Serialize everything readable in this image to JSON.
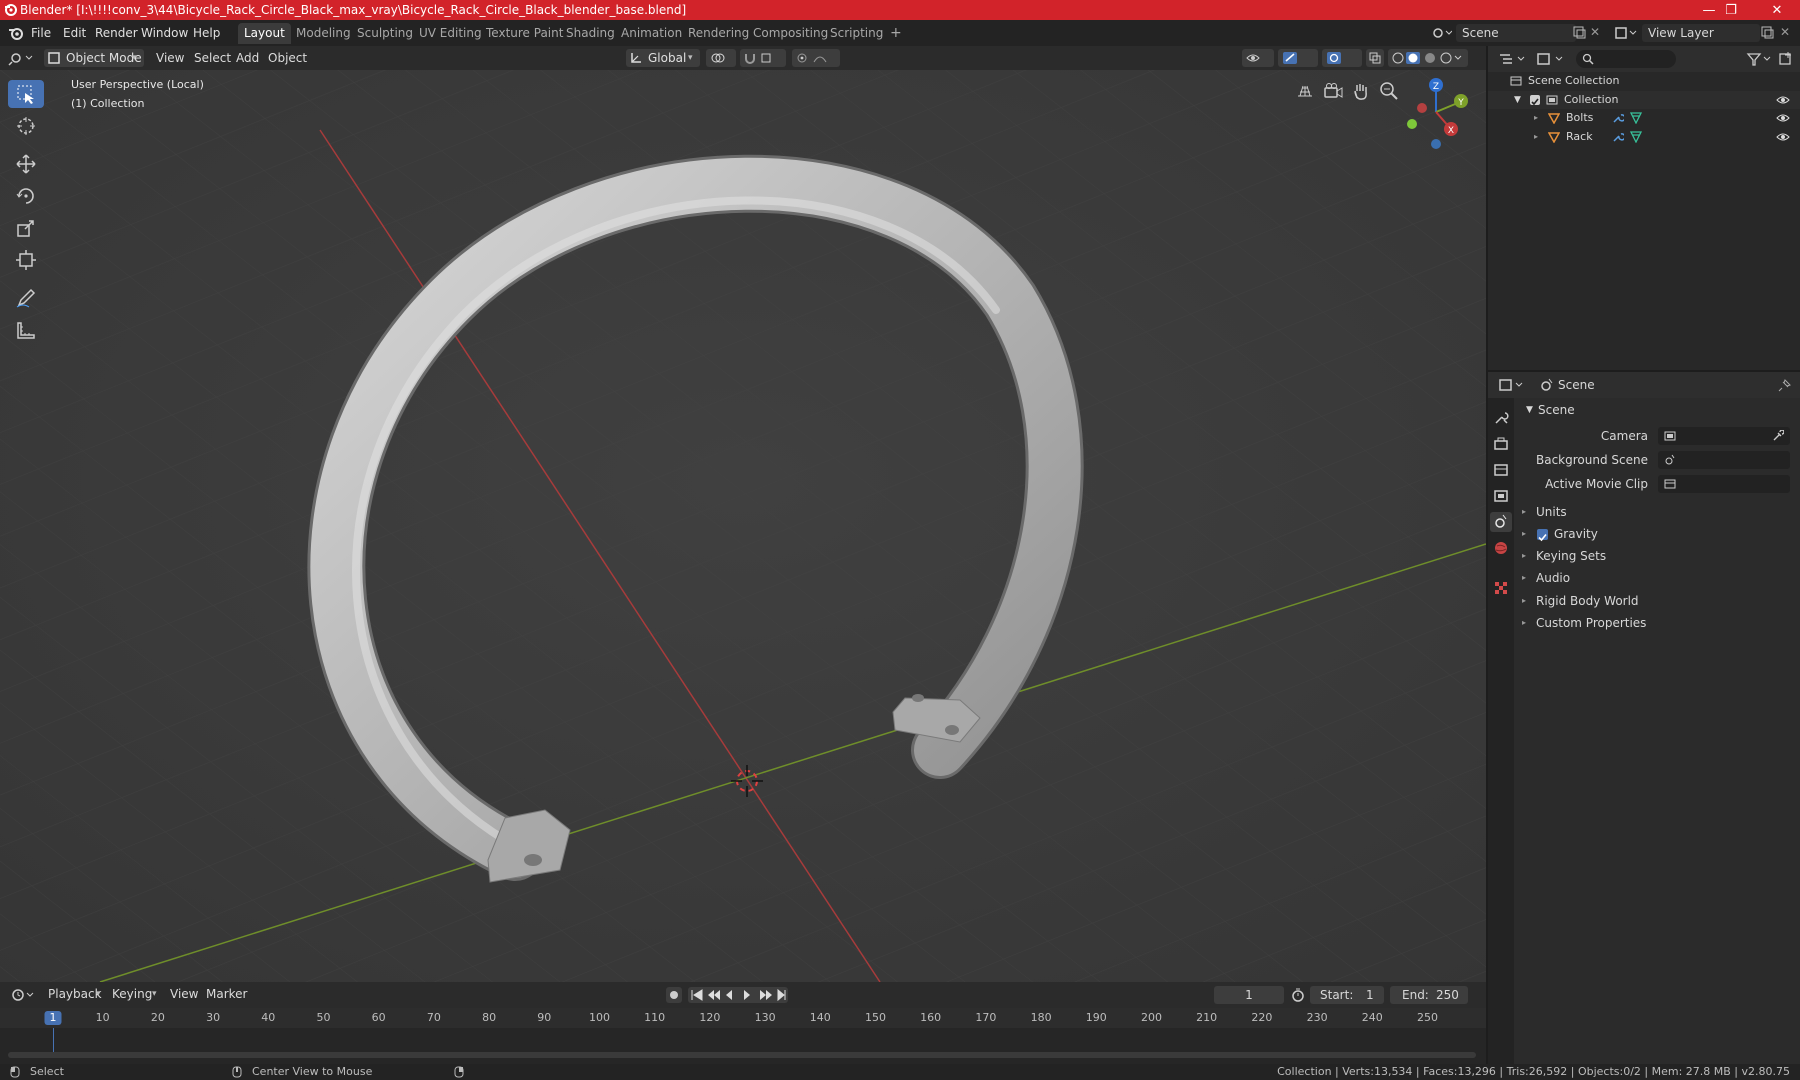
{
  "window": {
    "title": "Blender* [I:\\!!!!conv_3\\44\\Bicycle_Rack_Circle_Black_max_vray\\Bicycle_Rack_Circle_Black_blender_base.blend]",
    "minimize": "—",
    "maximize": "❐",
    "close": "✕"
  },
  "menu": [
    "File",
    "Edit",
    "Render",
    "Window",
    "Help"
  ],
  "workspaces": [
    "Layout",
    "Modeling",
    "Sculpting",
    "UV Editing",
    "Texture Paint",
    "Shading",
    "Animation",
    "Rendering",
    "Compositing",
    "Scripting"
  ],
  "active_workspace": "Layout",
  "add_workspace": "+",
  "scene_selector": "Scene",
  "view_layer_selector": "View Layer",
  "viewport_header": {
    "mode": "Object Mode",
    "menus": [
      "View",
      "Select",
      "Add",
      "Object"
    ],
    "transform_orientation": "Global"
  },
  "viewport": {
    "perspective_label": "User Perspective (Local)",
    "collection_label": "(1) Collection",
    "gizmo_axes": {
      "x": "X",
      "y": "Y",
      "z": "Z"
    }
  },
  "outliner": {
    "root": "Scene Collection",
    "collection": "Collection",
    "objects": [
      "Bolts",
      "Rack"
    ]
  },
  "properties": {
    "header": "Scene",
    "section": "Scene",
    "fields": [
      {
        "label": "Camera"
      },
      {
        "label": "Background Scene"
      },
      {
        "label": "Active Movie Clip"
      }
    ],
    "panels": [
      "Units",
      "Gravity",
      "Keying Sets",
      "Audio",
      "Rigid Body World",
      "Custom Properties"
    ],
    "gravity_checked": true
  },
  "timeline": {
    "menus": [
      "Playback",
      "Keying",
      "View",
      "Marker"
    ],
    "current_frame": "1",
    "start_label": "Start:",
    "start": "1",
    "end_label": "End:",
    "end": "250",
    "ticks": [
      "1",
      "10",
      "20",
      "30",
      "40",
      "50",
      "60",
      "70",
      "80",
      "90",
      "100",
      "110",
      "120",
      "130",
      "140",
      "150",
      "160",
      "170",
      "180",
      "190",
      "200",
      "210",
      "220",
      "230",
      "240",
      "250"
    ]
  },
  "statusbar": {
    "left1": "Select",
    "left2": "Center View to Mouse",
    "right": "Collection | Verts:13,534 | Faces:13,296 | Tris:26,592 | Objects:0/2 | Mem: 27.8 MB | v2.80.75"
  },
  "colors": {
    "titlebar": "#d2232a",
    "accent": "#4772b3",
    "x_axis": "#c33a3a",
    "y_axis": "#7ea12a",
    "z_axis": "#2f6fd0"
  }
}
